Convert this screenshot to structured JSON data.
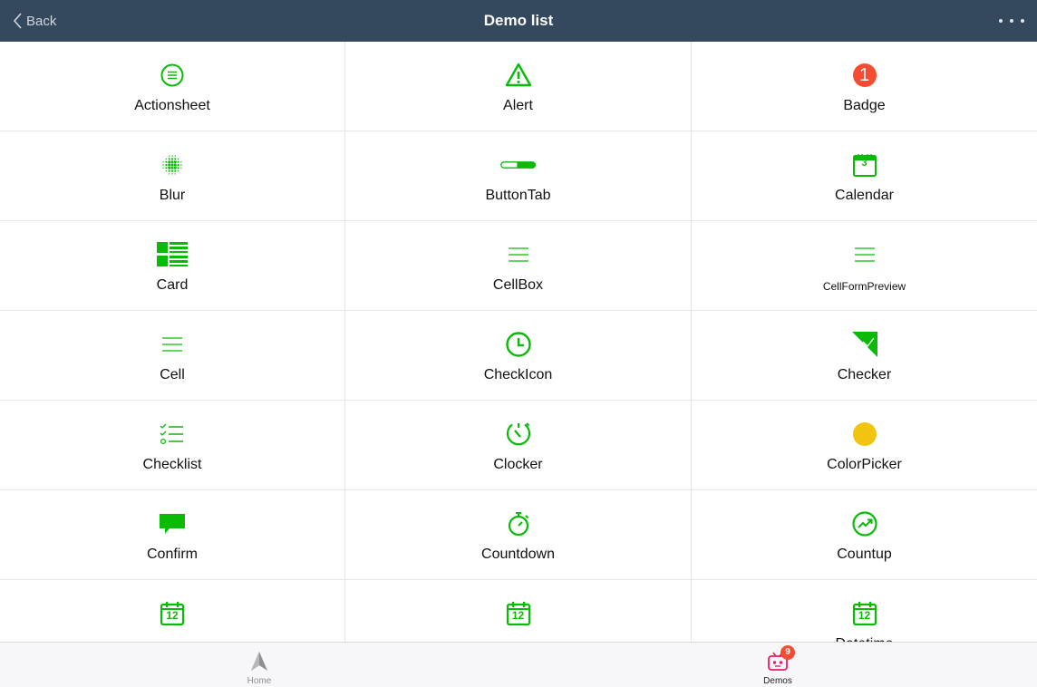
{
  "header": {
    "back_label": "Back",
    "title": "Demo list",
    "more_icon": "more-dots-icon"
  },
  "colors": {
    "header_bg": "#34495e",
    "accent_green": "#09bb07",
    "badge_red": "#f74c31",
    "colorpicker_yellow": "#f1c40f",
    "tab_active": "#e91e63"
  },
  "demos": [
    {
      "label": "Actionsheet",
      "icon": "list-circle-icon"
    },
    {
      "label": "Alert",
      "icon": "warning-triangle-icon"
    },
    {
      "label": "Badge",
      "icon": "badge-icon",
      "badge_text": "1"
    },
    {
      "label": "Blur",
      "icon": "blur-dots-icon"
    },
    {
      "label": "ButtonTab",
      "icon": "button-tab-icon"
    },
    {
      "label": "Calendar",
      "icon": "calendar-icon",
      "day": "3"
    },
    {
      "label": "Card",
      "icon": "card-icon"
    },
    {
      "label": "CellBox",
      "icon": "lines-icon"
    },
    {
      "label": "CellFormPreview",
      "icon": "lines-icon"
    },
    {
      "label": "Cell",
      "icon": "lines-icon"
    },
    {
      "label": "CheckIcon",
      "icon": "clock-icon"
    },
    {
      "label": "Checker",
      "icon": "checker-corner-icon"
    },
    {
      "label": "Checklist",
      "icon": "checklist-icon"
    },
    {
      "label": "Clocker",
      "icon": "clocker-icon"
    },
    {
      "label": "ColorPicker",
      "icon": "color-dot-icon"
    },
    {
      "label": "Confirm",
      "icon": "chat-bubble-icon"
    },
    {
      "label": "Countdown",
      "icon": "stopwatch-icon"
    },
    {
      "label": "Countup",
      "icon": "trend-up-icon"
    },
    {
      "label": "",
      "icon": "date-12-icon",
      "day": "12"
    },
    {
      "label": "",
      "icon": "date-12-icon",
      "day": "12"
    },
    {
      "label": "Datetime",
      "icon": "date-12-icon",
      "day": "12"
    }
  ],
  "tabbar": {
    "home": {
      "label": "Home",
      "icon": "navigation-arrow-icon"
    },
    "demos": {
      "label": "Demos",
      "icon": "robot-tv-icon",
      "badge": "9"
    }
  }
}
